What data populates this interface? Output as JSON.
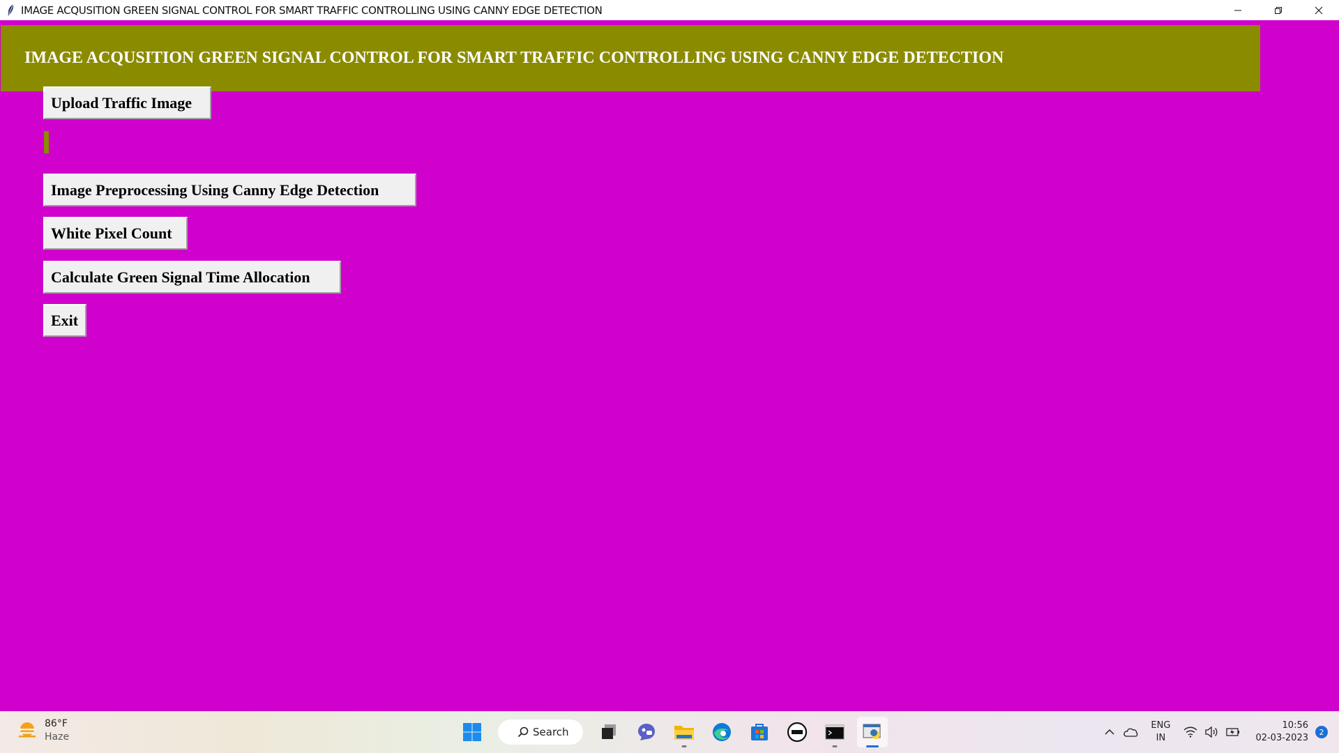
{
  "window": {
    "title": "IMAGE ACQUSITION GREEN SIGNAL CONTROL FOR SMART TRAFFIC CONTROLLING USING CANNY EDGE DETECTION"
  },
  "app": {
    "heading": "IMAGE ACQUSITION GREEN SIGNAL CONTROL FOR SMART TRAFFIC CONTROLLING USING CANNY EDGE DETECTION",
    "buttons": {
      "upload": "Upload Traffic Image",
      "canny": "Image Preprocessing Using Canny Edge Detection",
      "white_pixel": "White Pixel Count",
      "green_signal": "Calculate Green Signal Time Allocation",
      "exit": "Exit"
    },
    "colors": {
      "background": "#d000cd",
      "header": "#8b8b00",
      "button": "#f0f0f0"
    }
  },
  "taskbar": {
    "weather": {
      "temp": "86°F",
      "condition": "Haze"
    },
    "search_label": "Search",
    "tray": {
      "lang_line1": "ENG",
      "lang_line2": "IN",
      "time": "10:56",
      "date": "02-03-2023",
      "notifications": "2"
    }
  }
}
